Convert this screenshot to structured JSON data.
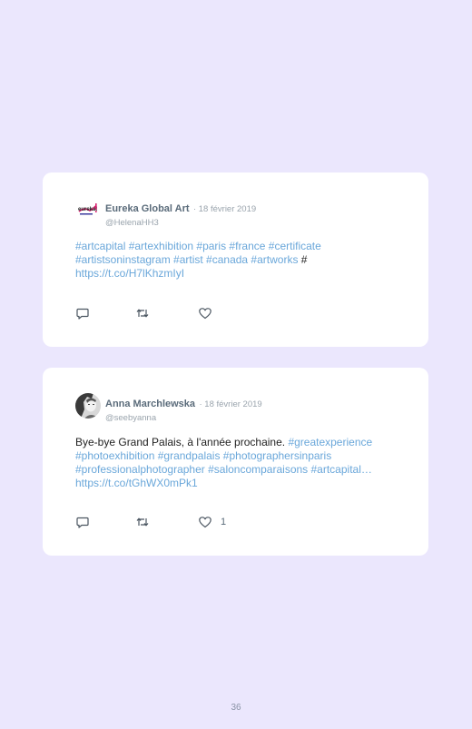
{
  "tweets": [
    {
      "author": "Eureka Global Art",
      "date": "· 18 février 2019",
      "handle": "@HelenaHH3",
      "logo_text": "eureka!",
      "body": [
        {
          "text": "#artcapital #artexhibition #paris #france #certificate #artistsoninstagram #artist #canada #artworks",
          "link": true
        },
        {
          "text": " # ",
          "link": false
        },
        {
          "text": "https://t.co/H7lKhzmIyI",
          "link": true
        }
      ],
      "like_count": ""
    },
    {
      "author": "Anna Marchlewska",
      "date": "· 18 février 2019",
      "handle": "@seebyanna",
      "body": [
        {
          "text": "Bye-bye Grand Palais, à l'année prochaine. ",
          "link": false
        },
        {
          "text": "#greatexperience #photoexhibition #grandpalais #photographersinparis #professionalphotographer #saloncomparaisons #artcapital… https://t.co/tGhWX0mPk1",
          "link": true
        }
      ],
      "like_count": "1"
    }
  ],
  "icons": [
    "reply-icon",
    "retweet-icon",
    "like-icon"
  ],
  "page_number": "36",
  "colors": {
    "background": "#ebe7fd",
    "link": "#6aa7da",
    "card": "#ffffff"
  }
}
